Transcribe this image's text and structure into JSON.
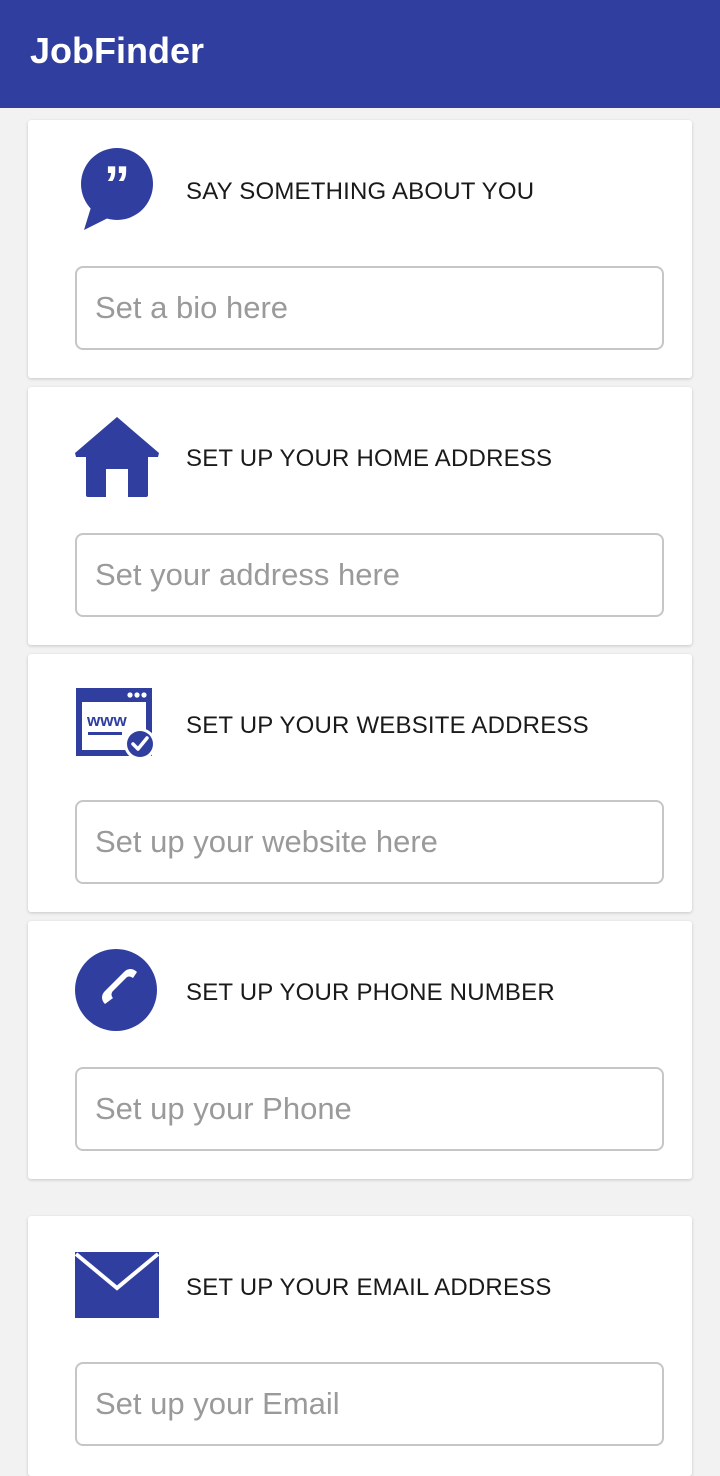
{
  "app": {
    "title": "JobFinder"
  },
  "colors": {
    "primary": "#303f9f",
    "background": "#f2f2f2"
  },
  "sections": [
    {
      "icon": "quote-bubble-icon",
      "label": "SAY SOMETHING ABOUT YOU",
      "placeholder": "Set a bio here",
      "value": ""
    },
    {
      "icon": "home-icon",
      "label": "SET UP YOUR HOME ADDRESS",
      "placeholder": "Set your address here",
      "value": ""
    },
    {
      "icon": "website-icon",
      "label": "SET UP YOUR WEBSITE ADDRESS",
      "placeholder": "Set up your website here",
      "value": ""
    },
    {
      "icon": "phone-icon",
      "label": "SET UP YOUR PHONE NUMBER",
      "placeholder": "Set up your Phone",
      "value": ""
    },
    {
      "icon": "email-icon",
      "label": "SET UP YOUR EMAIL ADDRESS",
      "placeholder": "Set up your Email",
      "value": ""
    }
  ]
}
